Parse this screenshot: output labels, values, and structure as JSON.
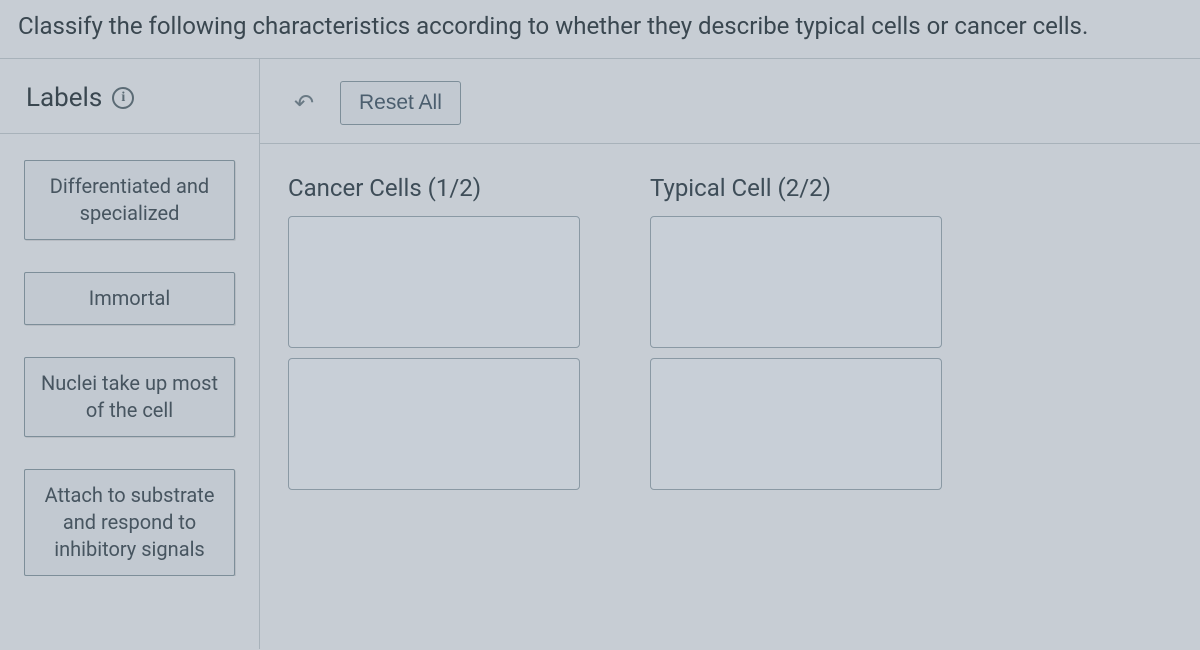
{
  "instruction": "Classify the following characteristics according to whether they describe typical cells or cancer cells.",
  "labelsPanel": {
    "title": "Labels",
    "items": [
      "Differentiated and specialized",
      "Immortal",
      "Nuclei take up most of the cell",
      "Attach to substrate and respond to inhibitory signals"
    ]
  },
  "toolbar": {
    "undo_glyph": "↶",
    "reset_label": "Reset All"
  },
  "dropColumns": [
    {
      "title": "Cancer Cells (1/2)",
      "slots": 2
    },
    {
      "title": "Typical Cell (2/2)",
      "slots": 2
    }
  ]
}
